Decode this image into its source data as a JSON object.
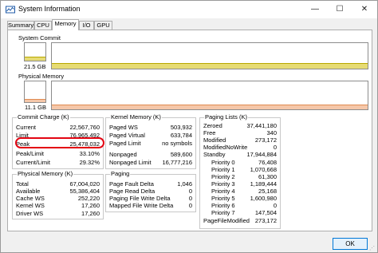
{
  "window": {
    "title": "System Information"
  },
  "controls": {
    "minimize": "—",
    "maximize": "☐",
    "close": "✕"
  },
  "tabs": [
    "Summary",
    "CPU",
    "Memory",
    "I/O",
    "GPU"
  ],
  "active_tab": "Memory",
  "colors": {
    "commit": "#e6db74",
    "physical": "#f5c7a9",
    "highlight": "#e30613"
  },
  "commit": {
    "label": "System Commit",
    "value": "21.5 GB",
    "fill_fraction": 0.22
  },
  "physical": {
    "label": "Physical Memory",
    "value": "11.1 GB",
    "fill_fraction": 0.17
  },
  "commit_charge": {
    "title": "Commit Charge (K)",
    "rows": [
      {
        "k": "Current",
        "v": "22,567,760"
      },
      {
        "k": "Limit",
        "v": "76,965,492"
      },
      {
        "k": "Peak",
        "v": "25,478,032"
      },
      {
        "k": "Peak/Limit",
        "v": "33.10%"
      },
      {
        "k": "Current/Limit",
        "v": "29.32%"
      }
    ]
  },
  "physical_memory": {
    "title": "Physical Memory (K)",
    "rows": [
      {
        "k": "Total",
        "v": "67,004,020"
      },
      {
        "k": "Available",
        "v": "55,386,404"
      },
      {
        "k": "Cache WS",
        "v": "252,220"
      },
      {
        "k": "Kernel WS",
        "v": "17,260"
      },
      {
        "k": "Driver WS",
        "v": "17,260"
      }
    ]
  },
  "kernel_memory": {
    "title": "Kernel Memory (K)",
    "rows": [
      {
        "k": "Paged WS",
        "v": "503,932"
      },
      {
        "k": "Paged Virtual",
        "v": "633,784"
      },
      {
        "k": "Paged Limit",
        "v": "no symbols"
      },
      {
        "k": "Nonpaged",
        "v": "589,600"
      },
      {
        "k": "Nonpaged Limit",
        "v": "16,777,216"
      }
    ]
  },
  "paging": {
    "title": "Paging",
    "rows": [
      {
        "k": "Page Fault Delta",
        "v": "1,046"
      },
      {
        "k": "Page Read Delta",
        "v": "0"
      },
      {
        "k": "Paging File Write Delta",
        "v": "0"
      },
      {
        "k": "Mapped File Write Delta",
        "v": "0"
      }
    ]
  },
  "paging_lists": {
    "title": "Paging Lists (K)",
    "rows": [
      {
        "k": "Zeroed",
        "v": "37,441,180"
      },
      {
        "k": "Free",
        "v": "340"
      },
      {
        "k": "Modified",
        "v": "273,172"
      },
      {
        "k": "ModifiedNoWrite",
        "v": "0"
      },
      {
        "k": "Standby",
        "v": "17,944,884"
      },
      {
        "k": "Priority 0",
        "v": "76,408"
      },
      {
        "k": "Priority 1",
        "v": "1,070,668"
      },
      {
        "k": "Priority 2",
        "v": "61,300"
      },
      {
        "k": "Priority 3",
        "v": "1,189,444"
      },
      {
        "k": "Priority 4",
        "v": "25,168"
      },
      {
        "k": "Priority 5",
        "v": "1,600,980"
      },
      {
        "k": "Priority 6",
        "v": "0"
      },
      {
        "k": "Priority 7",
        "v": "147,504"
      },
      {
        "k": "PageFileModified",
        "v": "273,172"
      }
    ]
  },
  "buttons": {
    "ok": "OK"
  }
}
